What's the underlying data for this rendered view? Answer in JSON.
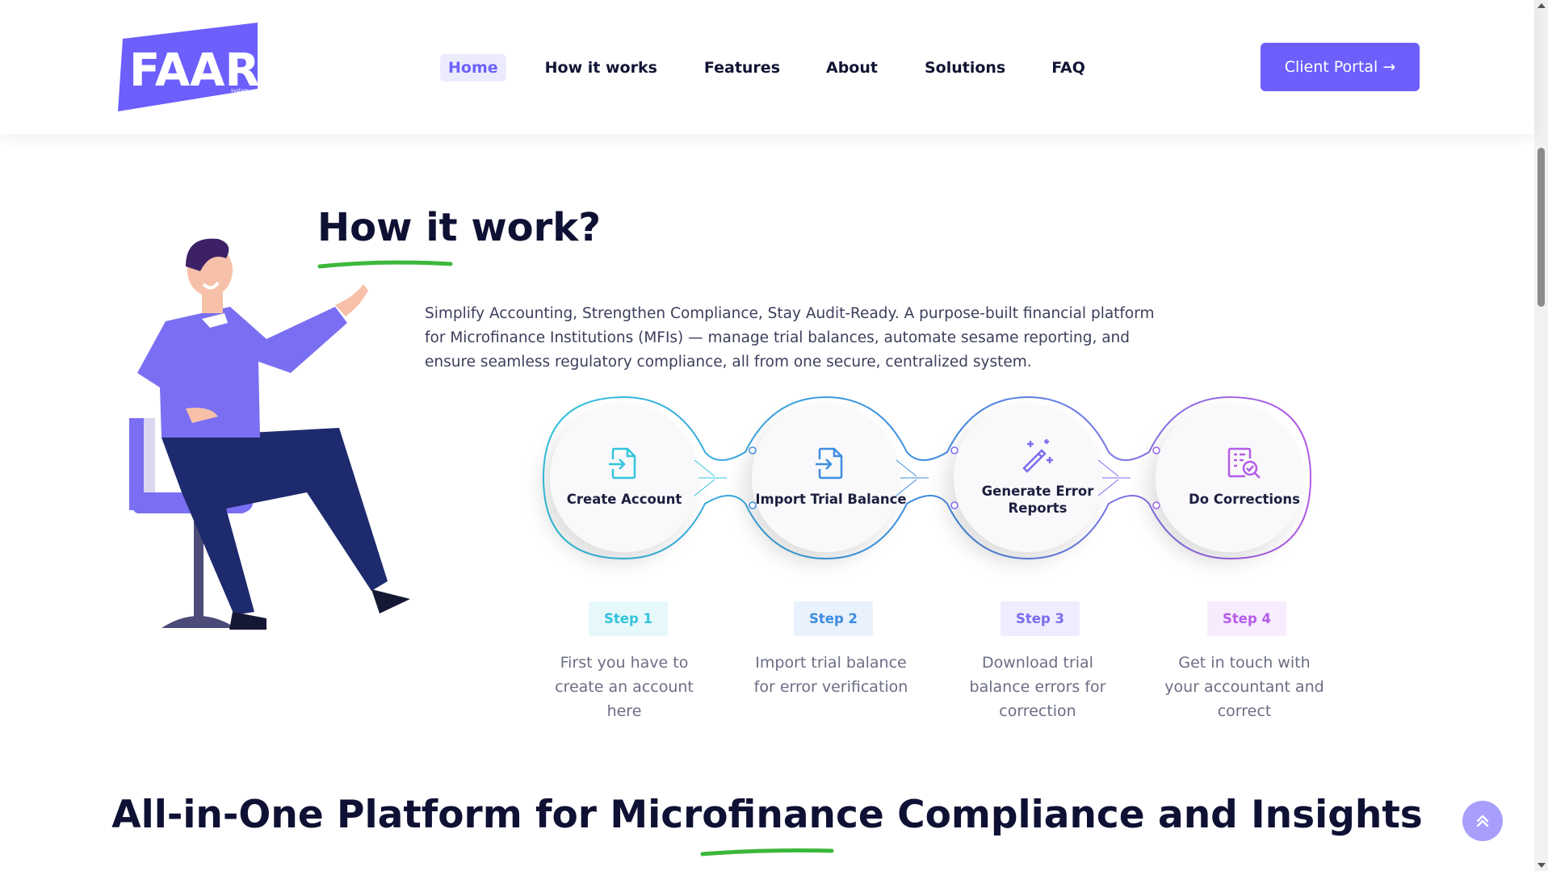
{
  "header": {
    "logo_text": "FAAR",
    "logo_subtext": "system",
    "nav": [
      {
        "label": "Home",
        "active": true
      },
      {
        "label": "How it works",
        "active": false
      },
      {
        "label": "Features",
        "active": false
      },
      {
        "label": "About",
        "active": false
      },
      {
        "label": "Solutions",
        "active": false
      },
      {
        "label": "FAQ",
        "active": false
      }
    ],
    "portal_button": "Client Portal →"
  },
  "how": {
    "title": "How it work?",
    "intro": "Simplify Accounting, Strengthen Compliance, Stay Audit-Ready. A purpose-built financial platform for Microfinance Institutions (MFIs) — manage trial balances, automate sesame reporting, and ensure seamless regulatory compliance, all from one secure, centralized system.",
    "steps": [
      {
        "title": "Create Account",
        "badge": "Step 1",
        "desc": "First you have to create an account here",
        "icon": "file-import-icon",
        "color": "#33c3dc"
      },
      {
        "title": "Import Trial Balance",
        "badge": "Step 2",
        "desc": "Import trial balance for error verification",
        "icon": "file-import-icon",
        "color": "#3d8de0"
      },
      {
        "title": "Generate Error Reports",
        "badge": "Step 3",
        "desc": "Download trial balance errors for correction",
        "icon": "magic-wand-icon",
        "color": "#7b6cf0"
      },
      {
        "title": "Do Corrections",
        "badge": "Step 4",
        "desc": "Get in touch with your accountant and correct",
        "icon": "document-search-icon",
        "color": "#b55be8"
      }
    ]
  },
  "bottom": {
    "title": "All-in-One Platform for Microfinance Compliance and Insights"
  },
  "colors": {
    "brand": "#6c5ffc",
    "accent_underline": "#3cb83c",
    "heading": "#0e1133"
  }
}
